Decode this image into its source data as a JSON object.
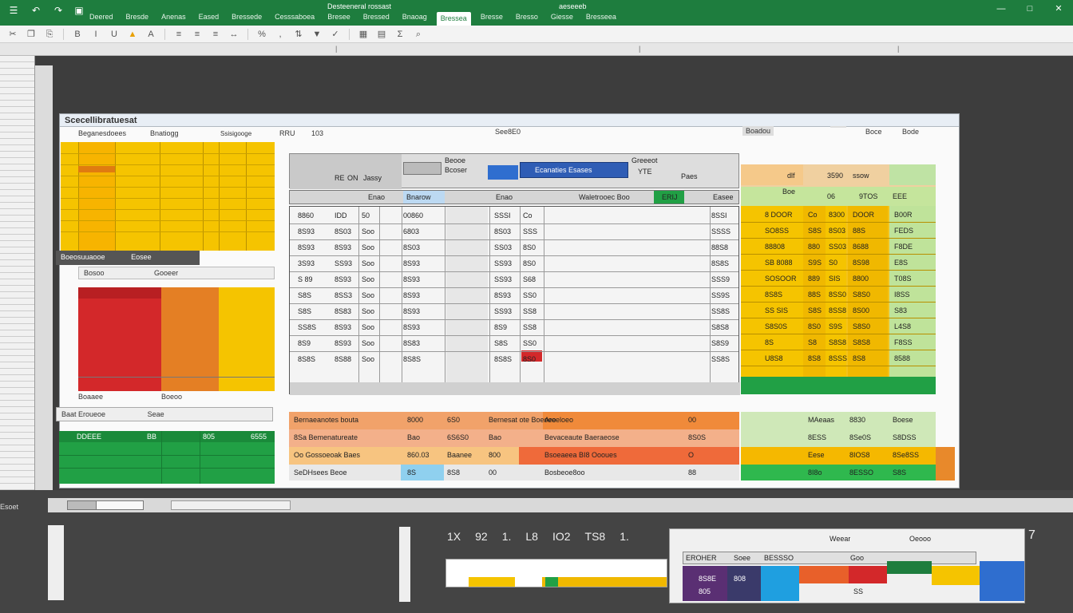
{
  "titlebar": {
    "tabs": [
      "Deered",
      "Bresde",
      "Anenas",
      "Eased",
      "Bressede",
      "Cesssaboea",
      "Bresee",
      "Bressed",
      "Bnaoag",
      "Bressea",
      "Bresse",
      "Bresso",
      "Giesse",
      "Bresseea"
    ],
    "doc_title": "Desteeneral rossast",
    "status": "aeseeeb"
  },
  "sheet": {
    "window_title": "Scecellibratuesat",
    "hdr_a": "Beganesdoees",
    "hdr_b": "Bnatiogg",
    "hdr_c": "Ssisigooge",
    "hdr_d": "RRU",
    "hdr_e": "103",
    "hdr_f": "See8E0",
    "hdr_g": "Boadou",
    "hdr_h": "Boce",
    "hdr_i": "Bode",
    "tab_left": "Beooe",
    "tab_mid": "Bcoser",
    "tab_sel": "Ecanaties Esases",
    "col_group": "Greeeot",
    "col_group2": "YTE",
    "col_group3": "Paes",
    "head_re": "RE",
    "head_on": "ON",
    "head_jassay": "Jassy",
    "head_row": [
      "Enao",
      "Bnarow",
      "Enao",
      "Waletrooec Boo",
      "ERIJ",
      "Easee"
    ],
    "right_headers": [
      "dlf",
      "3590",
      "ssow",
      "Boe",
      "06",
      "9TOS",
      "EEE"
    ],
    "left_mid_a": "Boeosuuaooe",
    "left_mid_b": "Eosee",
    "left_mid_c": "Bosoo",
    "left_mid_d": "Gooeer",
    "left_bottom_a": "Boaaee",
    "left_bottom_b": "Boeoo",
    "left_bottom_c": "Baat Eroueoe",
    "left_bottom_d": "Seae",
    "left_green": [
      "DDEEE",
      "BB",
      "805",
      "6555"
    ],
    "rows": [
      [
        "8860",
        "IDD",
        "50",
        "00860",
        "SSSI",
        "Co",
        "8SSI",
        "8 DOOR",
        "Co",
        "8300",
        "DOOR",
        "B00R"
      ],
      [
        "8S93",
        "8S03",
        "Soo",
        "6803",
        "8S03",
        "SSS",
        "SSSS",
        "SO8SS",
        "S8S",
        "8S03",
        "88S",
        "FEDS"
      ],
      [
        "8S93",
        "8S93",
        "Soo",
        "8S03",
        "SS03",
        "8S0",
        "88S8",
        "88808",
        "880",
        "SS03",
        "8688",
        "F8DE"
      ],
      [
        "3S93",
        "SS93",
        "Soo",
        "8S93",
        "SS93",
        "8S0",
        "8S8S",
        "SB 8088",
        "S9S",
        "S0",
        "8S98",
        "E8S"
      ],
      [
        "S 89",
        "8S93",
        "Soo",
        "8S93",
        "SS93",
        "S68",
        "SSS9",
        "SOSOOR",
        "889",
        "SIS",
        "8800",
        "T08S"
      ],
      [
        "S8S",
        "8SS3",
        "Soo",
        "8S93",
        "8S93",
        "SS0",
        "SS9S",
        "8S8S",
        "88S",
        "8SS0",
        "S8S0",
        "I8SS"
      ],
      [
        "S8S",
        "8S83",
        "Soo",
        "8S93",
        "SS93",
        "SS8",
        "SS8S",
        "SS SIS",
        "S8S",
        "8SS8",
        "8S00",
        "S83"
      ],
      [
        "SS8S",
        "8S93",
        "Soo",
        "8S93",
        "8S9",
        "SS8",
        "S8S8",
        "S8S0S",
        "8S0",
        "S9S",
        "S8S0",
        "L4S8"
      ],
      [
        "8S9",
        "8S93",
        "Soo",
        "8S83",
        "S8S",
        "SS0",
        "S8S9",
        "8S",
        "S8",
        "S8S8",
        "S8S8",
        "F8SS"
      ],
      [
        "8S8S",
        "8S88",
        "Soo",
        "8S8S",
        "8S8S",
        "8S0",
        "SS8S",
        "U8S8",
        "8S8",
        "8SSS",
        "8S8",
        "8588"
      ]
    ],
    "bottom_rows": [
      [
        "Bernaeanotes bouta",
        "8000",
        "6S0",
        "Bernesat ote Boeoee",
        "Aroeloeo",
        "00",
        "MAeaas",
        "8830",
        "Boese"
      ],
      [
        "8Sa Bemenatureate",
        "Bao",
        "6S6S0",
        "Bao",
        "Bevaceaute Baeraeose",
        "8S0S",
        "8ESS",
        "8Se0S",
        "S8DSS"
      ],
      [
        "Oo Gossoeoak Baes",
        "860.03",
        "Baanee",
        "800",
        "Bsoeaeea BI8 Oooues",
        "O",
        "Eese",
        "8IOS8",
        "8Se8SS"
      ],
      [
        "SeDHsees Beoe",
        "8S",
        "8S8",
        "00",
        "Bosbeoe8oo",
        "88",
        "8I8o",
        "8ESSO",
        "S8S"
      ]
    ]
  },
  "bottom": {
    "status_left": "Esoet",
    "num_row": [
      "1X",
      "92",
      "1.",
      "L8",
      "IO2",
      "TS8",
      "1."
    ],
    "pane2_title": "Weear",
    "pane2_title2": "Oeooo",
    "pane2_heads": [
      "EROHER",
      "Soee",
      "BESSSO",
      "Goo"
    ],
    "pane2_vals": [
      "8S8E",
      "808",
      "805",
      "SS"
    ],
    "seven": "7"
  },
  "colors": {
    "brand_green": "#1e7d3e",
    "yellow": "#f5c400",
    "orange": "#e8892b",
    "red": "#d9302b",
    "green": "#21a045",
    "blue": "#2f6ecf"
  }
}
